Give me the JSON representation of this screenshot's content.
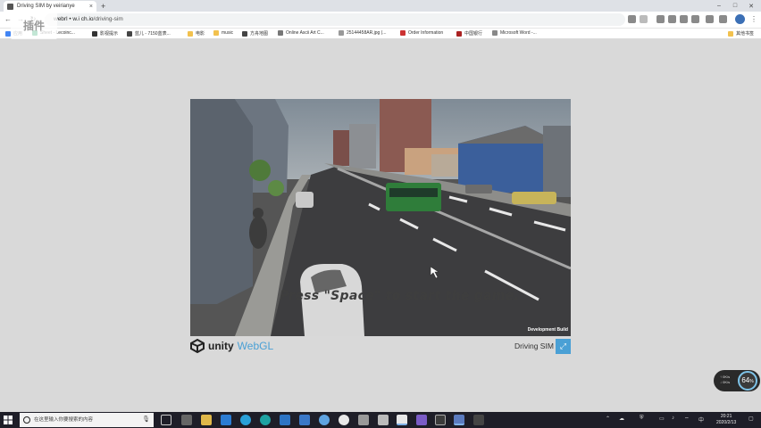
{
  "browser": {
    "tab_title": "Driving SIM by veirianye",
    "tab_close": "×",
    "new_tab": "+",
    "min": "–",
    "max": "□",
    "close": "✕",
    "url_prefix": "webrl • w.i ch.io",
    "url_path": "/driving-sim",
    "back": "←",
    "forward": "→",
    "reload": "↻"
  },
  "bookmarks": [
    {
      "label": "应用",
      "color": "#4285f4"
    },
    {
      "label": "Sheet - Lecoinc...",
      "color": "#0f9d58"
    },
    {
      "label": "影视提示",
      "color": "#e44"
    },
    {
      "label": "蓝儿 - 7150蓝表...",
      "color": "#444"
    },
    {
      "label": "电影",
      "color": "#f2c14e"
    },
    {
      "label": "music",
      "color": "#f2c14e"
    },
    {
      "label": "方舟地图",
      "color": "#444"
    },
    {
      "label": "Online Ascii Art C...",
      "color": "#777"
    },
    {
      "label": "25144458AR.jpg (...",
      "color": "#999"
    },
    {
      "label": "Order Information",
      "color": "#c33"
    },
    {
      "label": "中国银行",
      "color": "#a22"
    },
    {
      "label": "Microsoft Word -...",
      "color": "#888"
    },
    {
      "label": "其他书签",
      "color": "#f2c14e"
    }
  ],
  "logo_overlay": "插件",
  "game": {
    "prompt": "Press \"Space\" to start the game.",
    "dev_build": "Development Build"
  },
  "footer": {
    "unity_word": "unity",
    "webgl": "WebGL",
    "title": "Driving SIM",
    "fullscreen_icon": "⤢"
  },
  "net_widget": {
    "up": "↑ 0K/s",
    "down": "↓ 0K/s",
    "value": "64",
    "unit": "%"
  },
  "taskbar": {
    "search_placeholder": "在这里输入你要搜索的内容",
    "time": "20:21",
    "date": "2020/2/13",
    "ime": "中"
  }
}
